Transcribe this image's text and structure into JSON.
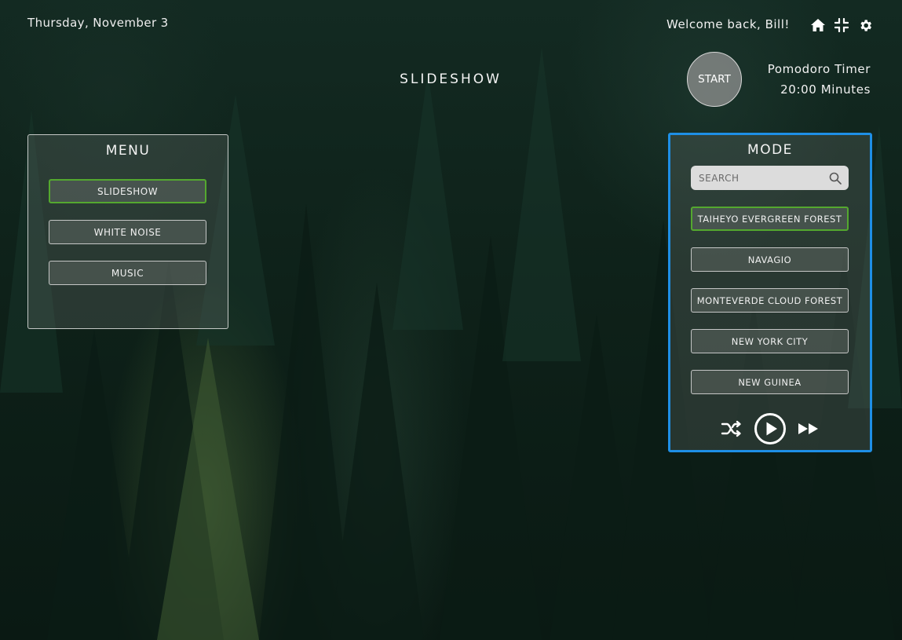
{
  "header": {
    "date": "Thursday, November 3",
    "welcome": "Welcome back, Bill!",
    "icons": [
      "home-icon",
      "compress-icon",
      "gear-icon"
    ]
  },
  "page_title": "SLIDESHOW",
  "pomodoro": {
    "start_label": "START",
    "title": "Pomodoro Timer",
    "duration": "20:00 Minutes"
  },
  "menu": {
    "title": "MENU",
    "items": [
      {
        "label": "SLIDESHOW",
        "active": true
      },
      {
        "label": "WHITE NOISE",
        "active": false
      },
      {
        "label": "MUSIC",
        "active": false
      }
    ]
  },
  "mode": {
    "title": "MODE",
    "search": {
      "placeholder": "SEARCH",
      "icon": "search-icon"
    },
    "items": [
      {
        "label": "TAIHEYO EVERGREEN FOREST",
        "active": true
      },
      {
        "label": "NAVAGIO",
        "active": false
      },
      {
        "label": "MONTEVERDE CLOUD FOREST",
        "active": false
      },
      {
        "label": "NEW YORK CITY",
        "active": false
      },
      {
        "label": "NEW GUINEA",
        "active": false
      }
    ],
    "controls": [
      "shuffle-icon",
      "play-icon",
      "fast-forward-icon"
    ]
  },
  "colors": {
    "active_border": "#54a82f",
    "mode_panel_border": "#1e8fe6",
    "background": "#0e2119"
  }
}
